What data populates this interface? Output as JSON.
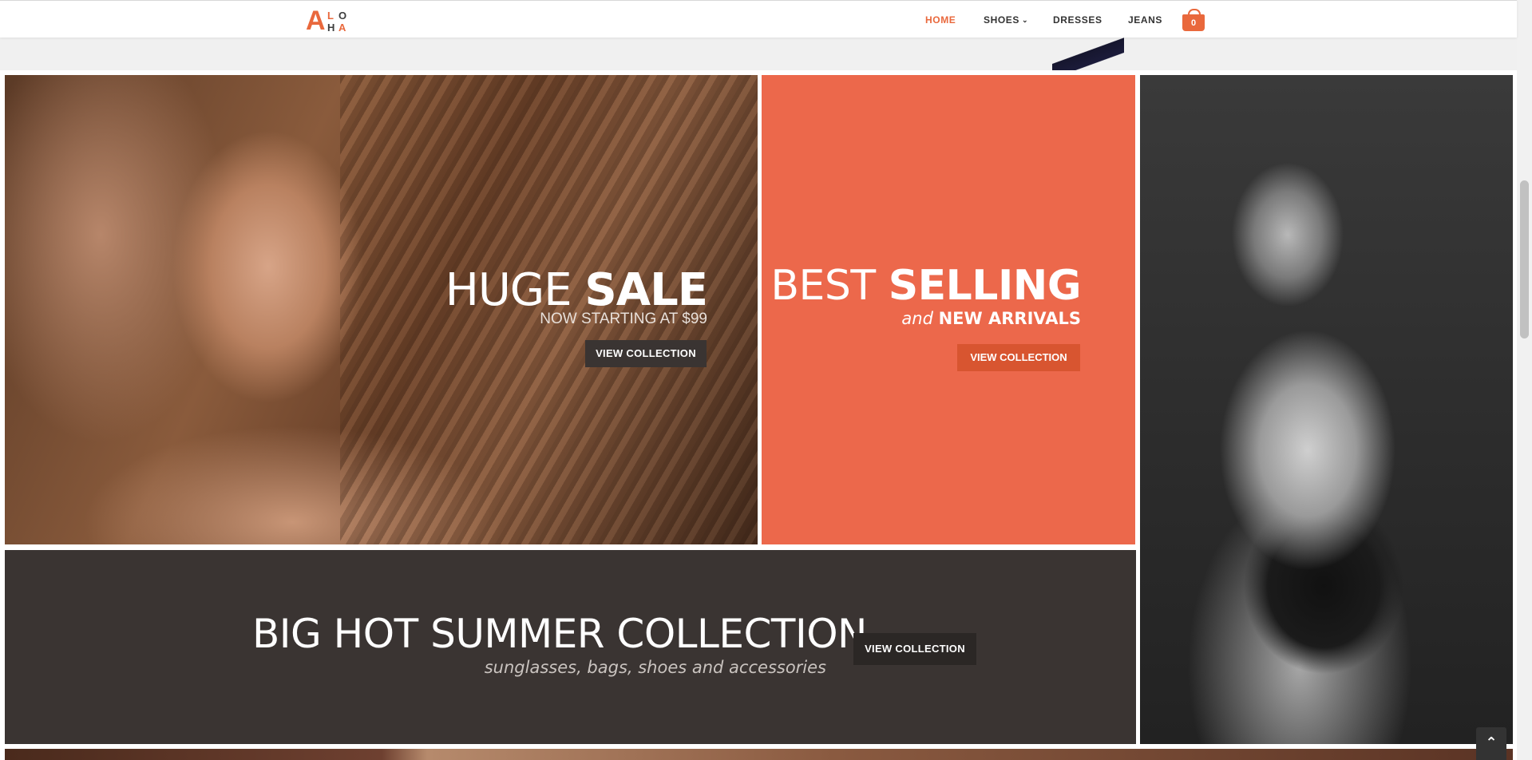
{
  "brand": {
    "logo_a": "A",
    "logo_l": "L",
    "logo_o": "O",
    "logo_h": "H",
    "logo_a2": "A",
    "accent_color": "#e9683c"
  },
  "nav": {
    "items": [
      {
        "label": "HOME",
        "active": true
      },
      {
        "label": "SHOES",
        "has_dropdown": true
      },
      {
        "label": "DRESSES"
      },
      {
        "label": "JEANS"
      }
    ],
    "cart_count": "0"
  },
  "tiles": {
    "sale": {
      "headline_light": "HUGE ",
      "headline_bold": "SALE",
      "subtitle": "NOW STARTING AT $99",
      "button": "VIEW COLLECTION"
    },
    "best": {
      "headline_light": "BEST ",
      "headline_bold": "SELLING",
      "sub_italic": "and ",
      "sub_bold": "NEW ARRIVALS",
      "button": "VIEW COLLECTION",
      "background_color": "#ec684b"
    },
    "summer": {
      "headline": "BIG HOT SUMMER COLLECTION",
      "subtitle": "sunglasses, bags, shoes and accessories",
      "button": "VIEW COLLECTION",
      "background_color": "#3a3432"
    }
  },
  "icons": {
    "cart": "shopping-bag-icon",
    "dropdown": "chevron-down-icon",
    "scroll_top": "chevron-up-icon"
  }
}
